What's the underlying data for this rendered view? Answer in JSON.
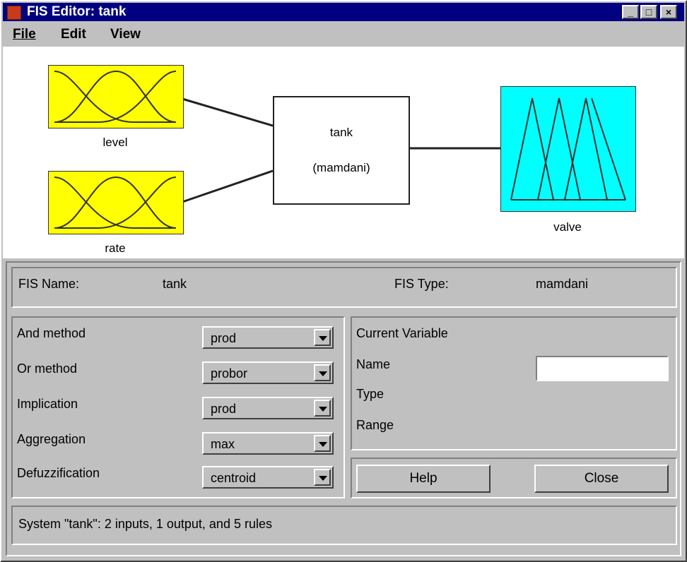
{
  "window": {
    "title": "FIS Editor: tank"
  },
  "menu": {
    "file": "File",
    "edit": "Edit",
    "view": "View"
  },
  "diagram": {
    "inputs": [
      "level",
      "rate"
    ],
    "system_name": "tank",
    "system_type": "(mamdani)",
    "output": "valve",
    "input_color": "#ffff00",
    "output_color": "#00ffff"
  },
  "fis": {
    "name_label": "FIS Name:",
    "name_value": "tank",
    "type_label": "FIS Type:",
    "type_value": "mamdani"
  },
  "methods": [
    {
      "label": "And method",
      "value": "prod"
    },
    {
      "label": "Or method",
      "value": "probor"
    },
    {
      "label": "Implication",
      "value": "prod"
    },
    {
      "label": "Aggregation",
      "value": "max"
    },
    {
      "label": "Defuzzification",
      "value": "centroid"
    }
  ],
  "current_variable": {
    "header": "Current Variable",
    "name_label": "Name",
    "type_label": "Type",
    "range_label": "Range",
    "name_value": ""
  },
  "buttons": {
    "help": "Help",
    "close": "Close"
  },
  "status": "System \"tank\": 2 inputs, 1 output, and 5 rules"
}
